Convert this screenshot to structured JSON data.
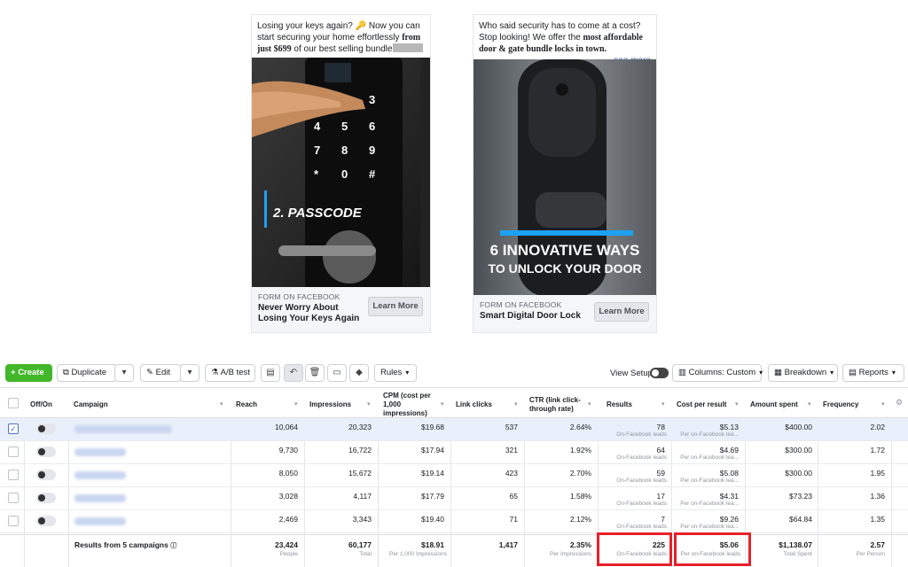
{
  "ads": [
    {
      "text_pre": "Losing your keys again? 🔑 Now you can start securing your home effortlessly ",
      "text_bold": "from just $699",
      "text_post": " of our best selling bundle",
      "see_more": "...see more",
      "image_caption": "2. PASSCODE",
      "keypad": [
        "3",
        "4",
        "5",
        "6",
        "7",
        "8",
        "9",
        "*",
        "0",
        "#"
      ],
      "kicker": "FORM ON FACEBOOK",
      "title": "Never Worry About Losing Your Keys Again",
      "cta": "Learn More"
    },
    {
      "text_pre": "Who said security has to come at a cost? Stop looking! We offer the ",
      "text_bold": "most affordable door & gate bundle locks in town.",
      "text_post": "",
      "see_more": "...see more",
      "image_caption_line1": "6 INNOVATIVE WAYS",
      "image_caption_line2": "TO UNLOCK YOUR DOOR",
      "kicker": "FORM ON FACEBOOK",
      "title": "Smart Digital Door Lock",
      "cta": "Learn More"
    }
  ],
  "toolbar": {
    "create": "Create",
    "duplicate": "Duplicate",
    "edit": "Edit",
    "ab_test": "A/B test",
    "rules": "Rules",
    "view_setup": "View Setup",
    "columns": "Columns: Custom",
    "breakdown": "Breakdown",
    "reports": "Reports"
  },
  "table": {
    "headers": {
      "off_on": "Off/On",
      "campaign": "Campaign",
      "reach": "Reach",
      "impressions": "Impressions",
      "cpm": "CPM (cost per 1,000 impressions)",
      "link_clicks": "Link clicks",
      "ctr": "CTR (link click-through rate)",
      "results": "Results",
      "cost_per_result": "Cost per result",
      "amount_spent": "Amount spent",
      "frequency": "Frequency"
    },
    "rows": [
      {
        "reach": "10,064",
        "impressions": "20,323",
        "cpm": "$19.68",
        "link_clicks": "537",
        "ctr": "2.64%",
        "results": "78",
        "results_sub": "On-Facebook leads",
        "cpr": "$5.13",
        "cpr_sub": "Per on-Facebook lea...",
        "spent": "$400.00",
        "frequency": "2.02"
      },
      {
        "reach": "9,730",
        "impressions": "16,722",
        "cpm": "$17.94",
        "link_clicks": "321",
        "ctr": "1.92%",
        "results": "64",
        "results_sub": "On-Facebook leads",
        "cpr": "$4.69",
        "cpr_sub": "Per on-Facebook lea...",
        "spent": "$300.00",
        "frequency": "1.72"
      },
      {
        "reach": "8,050",
        "impressions": "15,672",
        "cpm": "$19.14",
        "link_clicks": "423",
        "ctr": "2.70%",
        "results": "59",
        "results_sub": "On-Facebook leads",
        "cpr": "$5.08",
        "cpr_sub": "Per on-Facebook lea...",
        "spent": "$300.00",
        "frequency": "1.95"
      },
      {
        "reach": "3,028",
        "impressions": "4,117",
        "cpm": "$17.79",
        "link_clicks": "65",
        "ctr": "1.58%",
        "results": "17",
        "results_sub": "On-Facebook leads",
        "cpr": "$4.31",
        "cpr_sub": "Per on-Facebook lea...",
        "spent": "$73.23",
        "frequency": "1.36"
      },
      {
        "reach": "2,469",
        "impressions": "3,343",
        "cpm": "$19.40",
        "link_clicks": "71",
        "ctr": "2.12%",
        "results": "7",
        "results_sub": "On-Facebook leads",
        "cpr": "$9.26",
        "cpr_sub": "Per on-Facebook lea...",
        "spent": "$64.84",
        "frequency": "1.35"
      }
    ],
    "total": {
      "label": "Results from 5 campaigns",
      "reach": "23,424",
      "reach_sub": "People",
      "impressions": "60,177",
      "impressions_sub": "Total",
      "cpm": "$18.91",
      "cpm_sub": "Per 1,000 Impressions",
      "link_clicks": "1,417",
      "ctr": "2.35%",
      "ctr_sub": "Per Impressions",
      "results": "225",
      "results_sub": "On-Facebook leads",
      "cpr": "$5.06",
      "cpr_sub": "Per on-Facebook leads",
      "spent": "$1,138.07",
      "spent_sub": "Total Spent",
      "frequency": "2.57",
      "frequency_sub": "Per Person"
    }
  },
  "colors": {
    "create_green": "#42b72a",
    "highlight_red": "#e8202a",
    "selected_row": "#eaf0fb"
  }
}
